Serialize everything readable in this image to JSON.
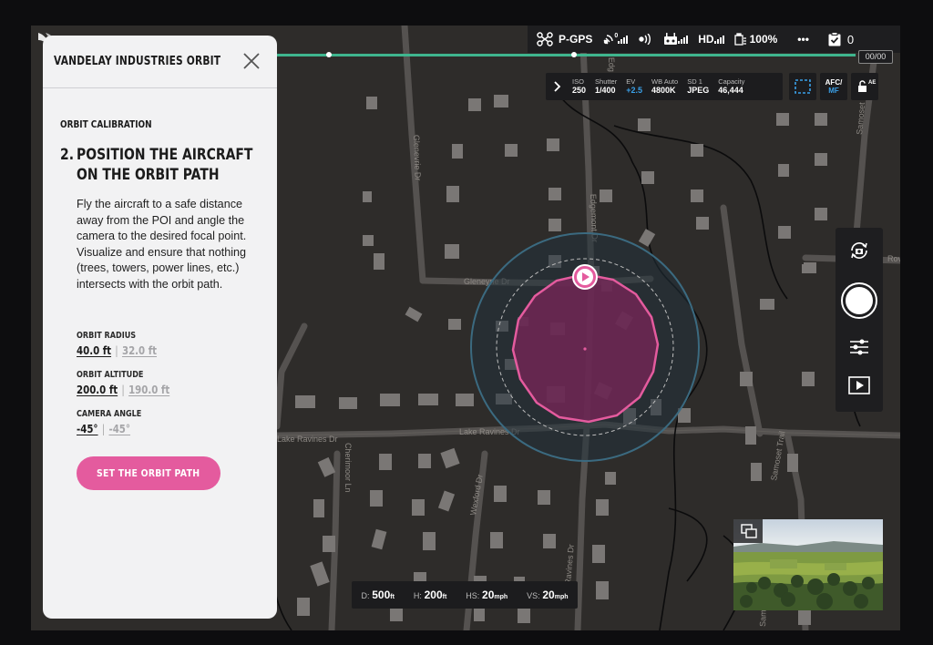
{
  "panel": {
    "title": "VANDELAY INDUSTRIES ORBIT",
    "section": "ORBIT CALIBRATION",
    "step_number": "2.",
    "step_title": "POSITION THE AIRCRAFT ON THE ORBIT PATH",
    "description": "Fly the aircraft to a safe distance away from the POI and angle the camera to the desired focal point. Visualize and ensure that nothing (trees, towers, power lines, etc.) intersects with the orbit path.",
    "fields": [
      {
        "label": "ORBIT RADIUS",
        "value": "40.0 ft",
        "alt": "32.0 ft"
      },
      {
        "label": "ORBIT ALTITUDE",
        "value": "200.0 ft",
        "alt": "190.0 ft"
      },
      {
        "label": "CAMERA ANGLE",
        "value": "-45°",
        "alt": "-45°"
      }
    ],
    "button": "SET THE ORBIT PATH"
  },
  "topbar": {
    "gps": "P-GPS",
    "satellite_count": "0",
    "video_label": "HD",
    "battery": "100%",
    "more": "•••",
    "checklist_count": "0",
    "waypoint_counter": "00/00"
  },
  "camera": {
    "settings": [
      {
        "key": "ISO",
        "value": "250"
      },
      {
        "key": "Shutter",
        "value": "1/400"
      },
      {
        "key": "EV",
        "value": "+2.5",
        "accent": true
      },
      {
        "key": "WB Auto",
        "value": "4800K"
      },
      {
        "key": "SD 1",
        "value": "JPEG"
      },
      {
        "key": "Capacity",
        "value": "46,444"
      }
    ],
    "focus_top": "AFC/",
    "focus_bottom": "MF",
    "ae": "AE"
  },
  "telemetry": [
    {
      "key": "D:",
      "value": "500",
      "unit": "ft"
    },
    {
      "key": "H:",
      "value": "200",
      "unit": "ft"
    },
    {
      "key": "HS:",
      "value": "20",
      "unit": "mph"
    },
    {
      "key": "VS:",
      "value": "20",
      "unit": "mph"
    }
  ],
  "map_labels": {
    "glenevrie_vertical": "Glenevrie Dr",
    "glenevrie": "Gleneyrie Dr",
    "edgemont": "Edgemont Dr",
    "edge": "Edg",
    "samoset_top": "Samoset",
    "samoset_trail": "Samoset Trail",
    "samo_bottom": "Samo",
    "lake_ravines_left": "Lake Ravines Dr",
    "lake_ravines_right": "Lake Ravines Dr",
    "cherimoor": "Cherimoor Ln",
    "wexford": "Wexford Dr",
    "ravines": "Ravines Dr",
    "rov": "Rov"
  },
  "colors": {
    "orbit_pink": "#e45b9e",
    "accent_blue": "#3aa0e8",
    "progress_green": "#3fb58e",
    "map_background": "#2e2c2a"
  },
  "icons": {
    "aircraft": "drone-icon",
    "satellite": "satellite-icon",
    "wifi": "wifi-icon",
    "remote": "remote-controller-icon",
    "battery": "battery-icon",
    "checklist": "checklist-icon",
    "switch_camera": "switch-camera-icon",
    "shutter": "shutter-button-icon",
    "settings": "sliders-icon",
    "playback": "playback-icon"
  }
}
